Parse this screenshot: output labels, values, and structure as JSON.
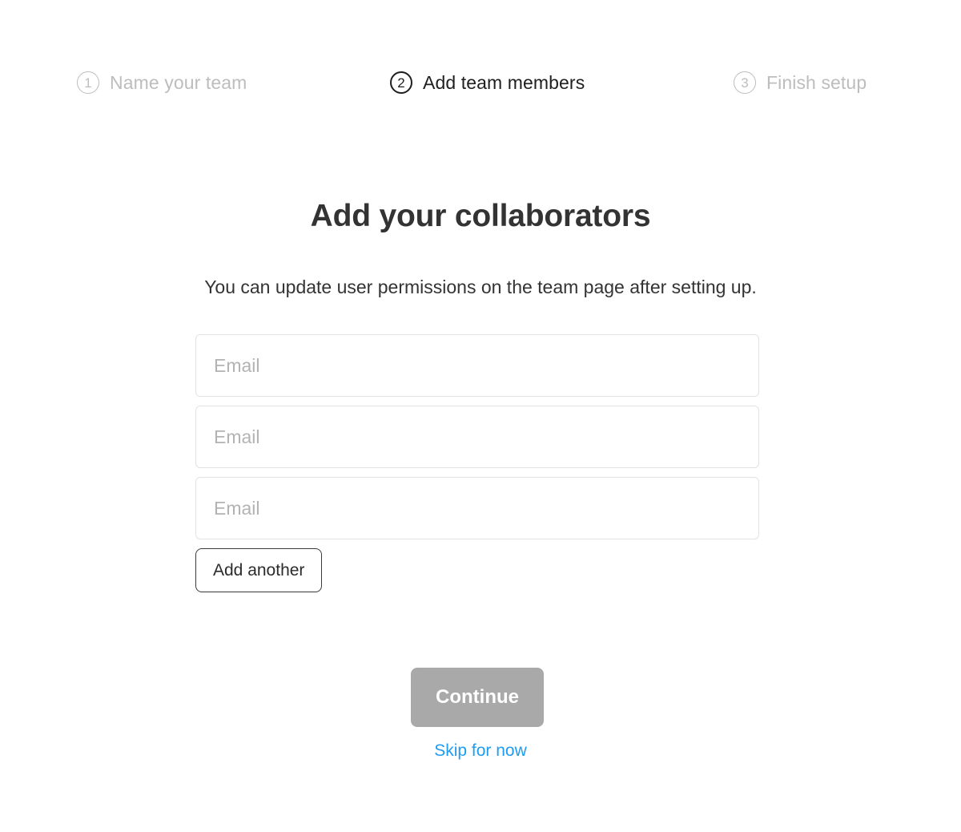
{
  "stepper": {
    "steps": [
      {
        "number": "1",
        "label": "Name your team",
        "state": "inactive"
      },
      {
        "number": "2",
        "label": "Add team members",
        "state": "active"
      },
      {
        "number": "3",
        "label": "Finish setup",
        "state": "inactive"
      }
    ]
  },
  "main": {
    "headline": "Add your collaborators",
    "subhead": "You can update user permissions on the team page after setting up."
  },
  "form": {
    "fields": [
      {
        "placeholder": "Email",
        "value": ""
      },
      {
        "placeholder": "Email",
        "value": ""
      },
      {
        "placeholder": "Email",
        "value": ""
      }
    ],
    "add_another_label": "Add another"
  },
  "footer": {
    "continue_label": "Continue",
    "skip_label": "Skip for now"
  },
  "colors": {
    "active_step": "#1f1f1f",
    "inactive_step": "#bdbdbd",
    "text": "#333333",
    "input_border": "#e2e2e2",
    "placeholder": "#b3b3b3",
    "continue_bg": "#a9a9a9",
    "continue_text": "#ffffff",
    "link_blue": "#1e9cf0",
    "background": "#ffffff"
  }
}
